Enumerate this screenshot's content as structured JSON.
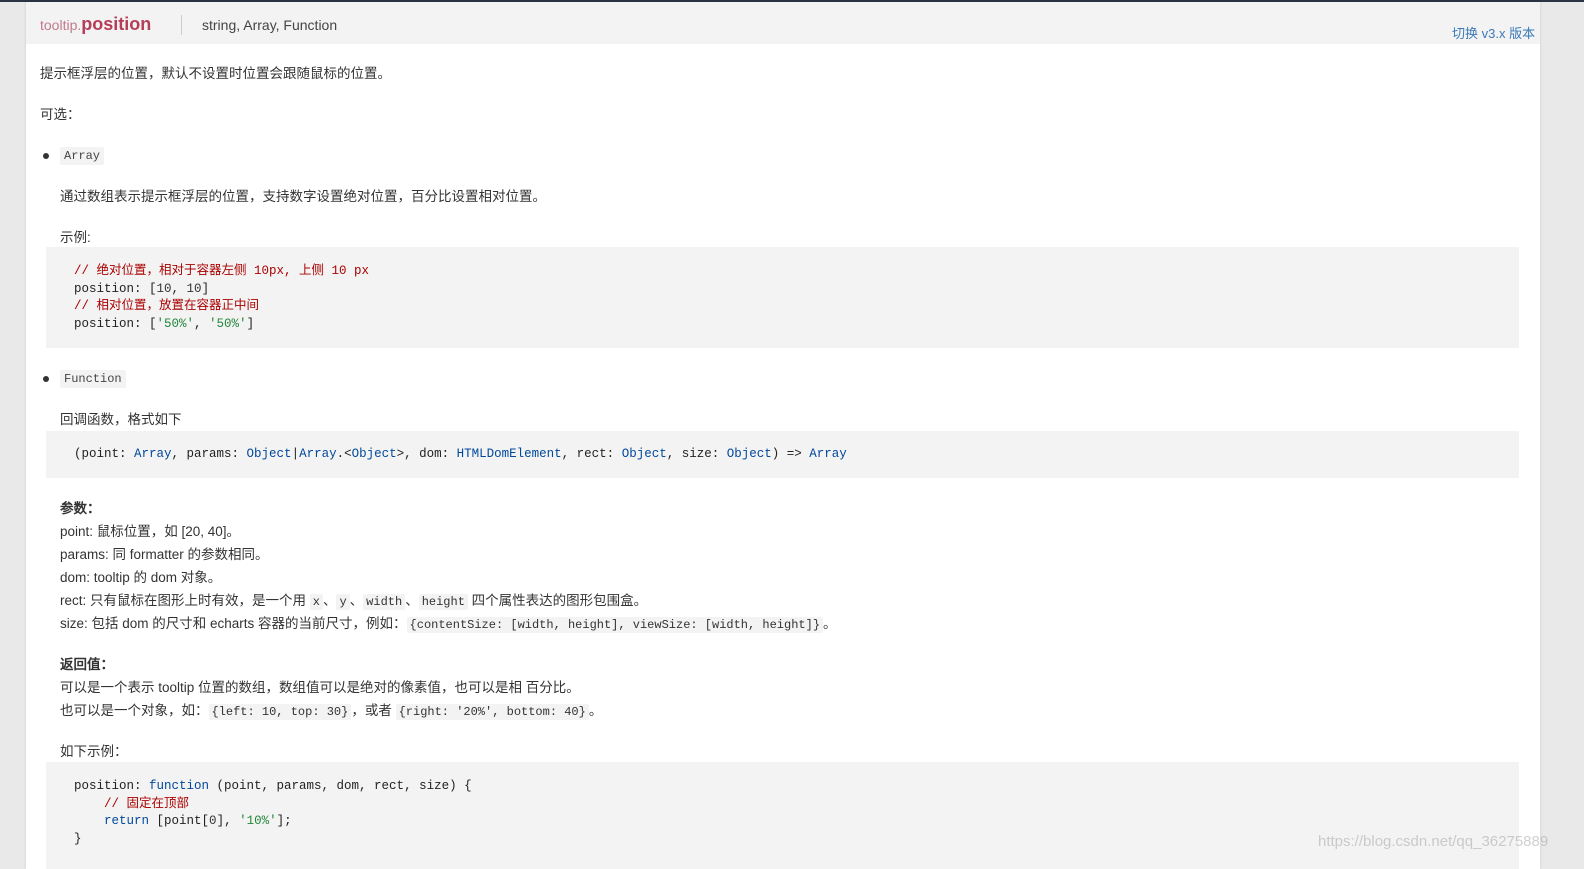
{
  "header": {
    "path": "tooltip.",
    "name": "position",
    "types": "string, Array, Function",
    "version_link": "切换 v3.x 版本"
  },
  "intro": "提示框浮层的位置，默认不设置时位置会跟随鼠标的位置。",
  "optional_label": "可选：",
  "array_item": {
    "chip": "Array",
    "desc": "通过数组表示提示框浮层的位置，支持数字设置绝对位置，百分比设置相对位置。",
    "example_label": "示例:",
    "code": [
      "// 绝对位置，相对于容器左侧 10px, 上侧 10 px",
      "position: [10, 10]",
      "// 相对位置，放置在容器正中间",
      "position: ['50%', '50%']"
    ]
  },
  "function_item": {
    "chip": "Function",
    "desc": "回调函数，格式如下",
    "signature": "(point: Array, params: Object|Array.<Object>, dom: HTMLDomElement, rect: Object, size: Object) => Array",
    "params_title": "参数：",
    "params": {
      "point": "point: 鼠标位置，如 [20, 40]。",
      "params": "params: 同 formatter 的参数相同。",
      "dom": "dom: tooltip 的 dom 对象。",
      "rect_pre": "rect: 只有鼠标在图形上时有效，是一个用 ",
      "rect_x": "x",
      "rect_y": "y",
      "rect_w": "width",
      "rect_h": "height",
      "rect_post": " 四个属性表达的图形包围盒。",
      "size_pre": "size: 包括 dom 的尺寸和 echarts 容器的当前尺寸，例如：",
      "size_code": "{contentSize: [width, height], viewSize: [width, height]}",
      "size_post": "。"
    },
    "return_title": "返回值：",
    "return_line1": "可以是一个表示 tooltip 位置的数组，数组值可以是绝对的像素值，也可以是相 百分比。",
    "return_line2_pre": "也可以是一个对象，如：",
    "return_code1": "{left: 10, top: 30}",
    "return_mid": "，或者 ",
    "return_code2": "{right: '20%', bottom: 40}",
    "return_post": "。",
    "example_label": "如下示例：",
    "code": [
      "position: function (point, params, dom, rect, size) {",
      "    // 固定在顶部",
      "    return [point[0], '10%'];",
      "}"
    ]
  },
  "watermark": "https://blog.csdn.net/qq_36275889"
}
